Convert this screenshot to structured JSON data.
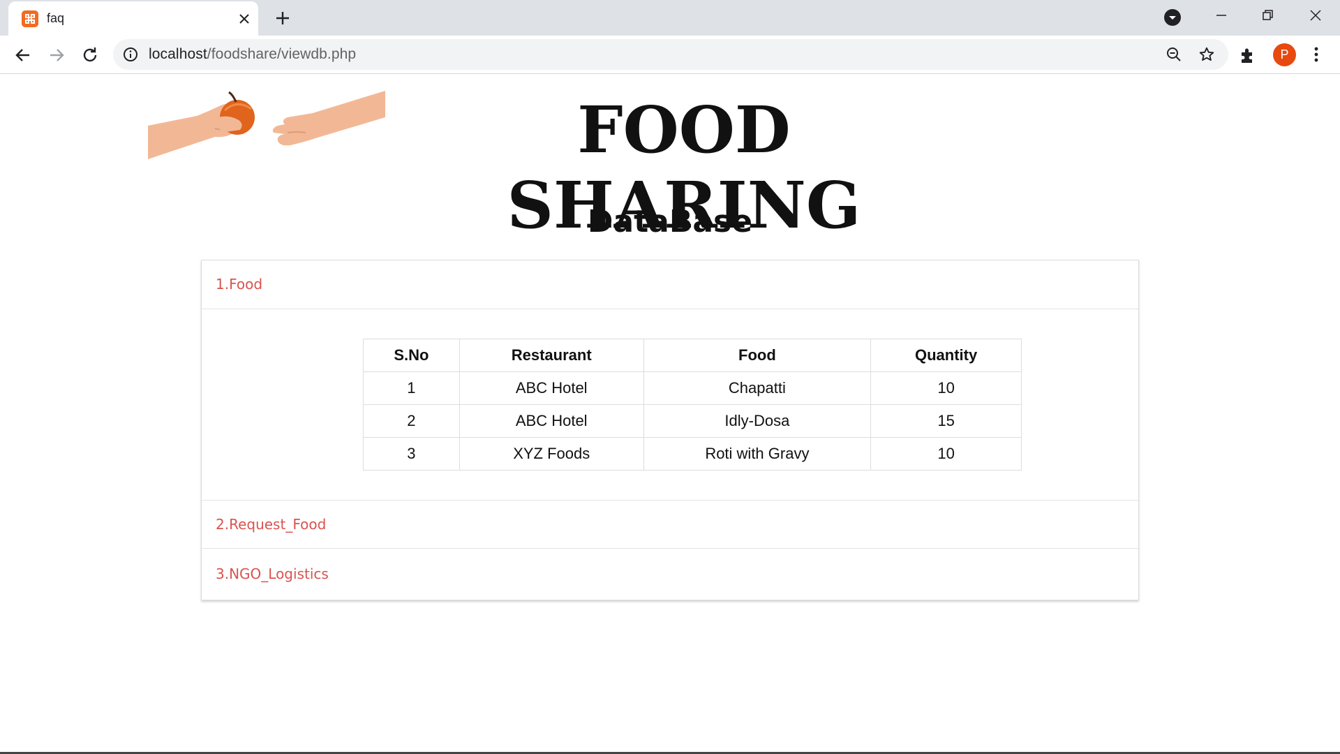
{
  "browser": {
    "tab": {
      "title": "faq",
      "favicon": "xampp-icon"
    },
    "address": {
      "host": "localhost",
      "path": "/foodshare/viewdb.php"
    },
    "profile_initial": "P"
  },
  "page": {
    "title": "FOOD SHARING",
    "heading": "DataBase",
    "sections": [
      {
        "label": "1.Food",
        "expanded": true
      },
      {
        "label": "2.Request_Food",
        "expanded": false
      },
      {
        "label": "3.NGO_Logistics",
        "expanded": false
      }
    ],
    "table": {
      "headers": [
        "S.No",
        "Restaurant",
        "Food",
        "Quantity"
      ],
      "rows": [
        [
          "1",
          "ABC Hotel",
          "Chapatti",
          "10"
        ],
        [
          "2",
          "ABC Hotel",
          "Idly-Dosa",
          "15"
        ],
        [
          "3",
          "XYZ Foods",
          "Roti with Gravy",
          "10"
        ]
      ]
    }
  },
  "colors": {
    "accordion_link": "#d9534f",
    "avatar": "#e8490f",
    "favicon": "#f26b21"
  }
}
